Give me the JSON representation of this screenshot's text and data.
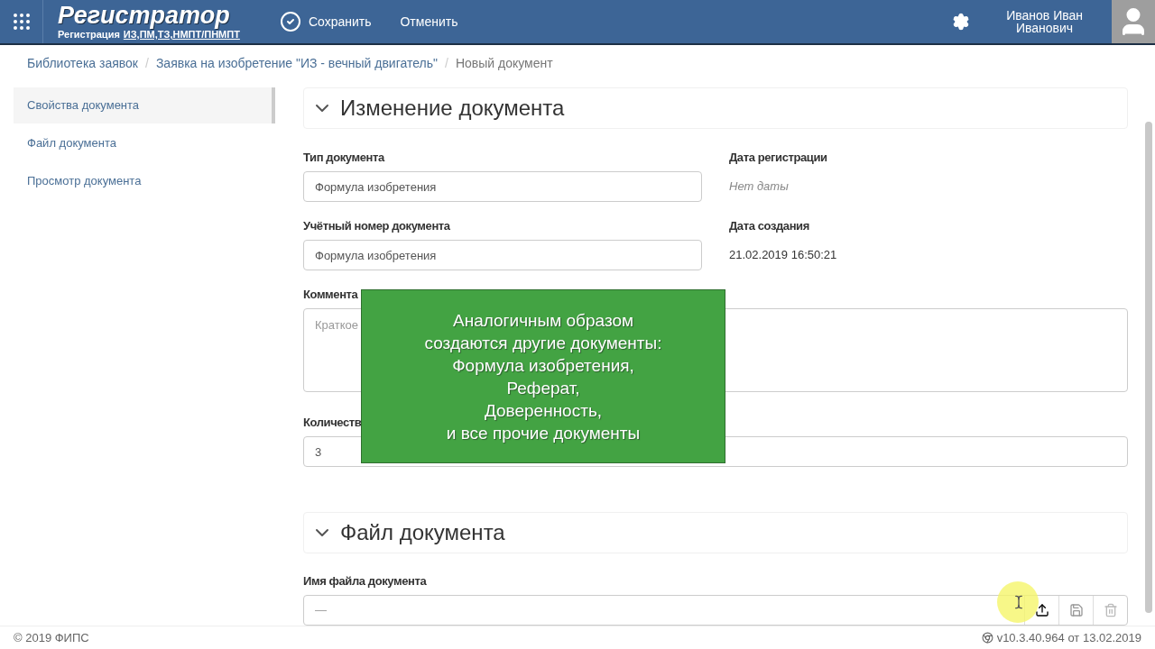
{
  "header": {
    "title": "Регистратор",
    "subtitle": "Регистрация",
    "codes": "ИЗ,ПМ,ТЗ,НМПТ/ПНМПТ",
    "save": "Сохранить",
    "cancel": "Отменить",
    "user": [
      "Иванов Иван",
      "Иванович"
    ]
  },
  "breadcrumbs": [
    {
      "label": "Библиотека заявок",
      "kind": "link"
    },
    {
      "label": "/",
      "kind": "separator"
    },
    {
      "label": "Заявка на изобретение \"ИЗ - вечный двигатель\"",
      "kind": "link"
    },
    {
      "label": "/",
      "kind": "separator"
    },
    {
      "label": "Новый документ",
      "kind": "current"
    }
  ],
  "sidebar": {
    "items": [
      {
        "label": "Свойства документа",
        "selected": true
      },
      {
        "label": "Файл документа",
        "selected": false
      },
      {
        "label": "Просмотр документа",
        "selected": false
      }
    ]
  },
  "edit_section": {
    "title": "Изменение документа",
    "expanded": true,
    "doc_type": {
      "label": "Тип документа",
      "value": "Формула изобретения"
    },
    "reg_date": {
      "label": "Дата регистрации",
      "value": "Нет даты"
    },
    "account_number": {
      "label": "Учётный номер документа",
      "value": "Формула изобретения"
    },
    "created": {
      "label": "Дата создания",
      "value": "21.02.2019 16:50:21"
    },
    "comment": {
      "label": "Коммента",
      "placeholder": "Краткое"
    },
    "claims": {
      "label": "Количеств",
      "value": "3"
    }
  },
  "file_section": {
    "title": "Файл документа",
    "expanded": true,
    "file_name": {
      "label": "Имя файла документа",
      "placeholder": "—"
    }
  },
  "overlay": {
    "lines": [
      "Аналогичным образом",
      "создаются другие документы:",
      "Формула изобретения,",
      "Реферат,",
      "Доверенность,",
      "и все прочие документы"
    ]
  },
  "footer": {
    "copyright": "© 2019 ФИПС",
    "version": "v10.3.40.964 от 13.02.2019"
  }
}
